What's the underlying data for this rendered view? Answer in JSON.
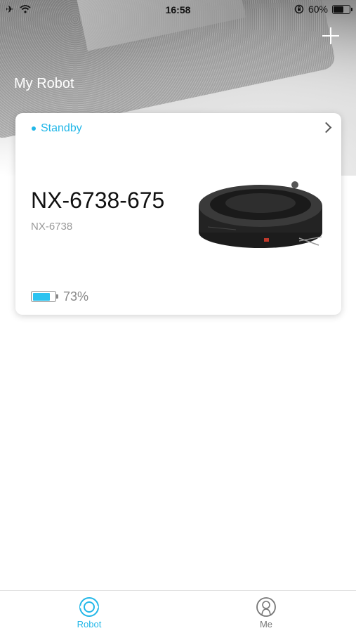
{
  "status_bar": {
    "time": "16:58",
    "battery_percent_label": "60%",
    "battery_level": 0.6,
    "icons": [
      "airplane-icon",
      "wifi-icon",
      "rotation-lock-icon",
      "battery-icon"
    ]
  },
  "header": {
    "title": "My Robot",
    "add_icon": "plus-icon"
  },
  "robot_card": {
    "status": "Standby",
    "status_color": "#22b7e8",
    "name": "NX-6738-675",
    "model": "NX-6738",
    "battery_label": "73%",
    "battery_level": 0.73,
    "battery_color": "#2dc3f0"
  },
  "tabbar": {
    "tabs": [
      {
        "label": "Robot",
        "icon": "robot-icon",
        "active": true
      },
      {
        "label": "Me",
        "icon": "user-icon",
        "active": false
      }
    ],
    "accent": "#22b7e8"
  }
}
